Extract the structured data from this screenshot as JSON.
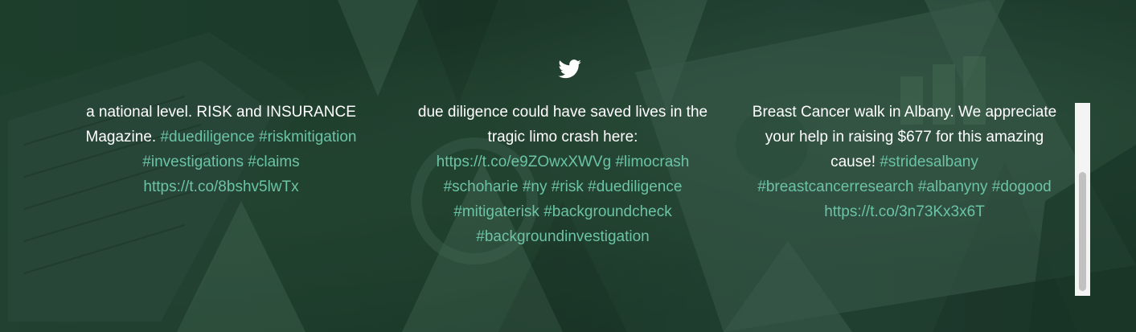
{
  "icons": {
    "twitter": "twitter-bird-icon"
  },
  "colors": {
    "link": "#6cc3a6",
    "text": "#ffffff",
    "background": "#1d3d2b"
  },
  "tweets": [
    {
      "lines": [
        {
          "parts": [
            {
              "t": "a national level. RISK and INSURANCE",
              "link": false
            }
          ]
        },
        {
          "parts": [
            {
              "t": "Magazine. ",
              "link": false
            },
            {
              "t": "#duediligence",
              "link": true
            },
            {
              "t": " ",
              "link": false
            },
            {
              "t": "#riskmitigation",
              "link": true
            }
          ]
        },
        {
          "parts": [
            {
              "t": "#investigations",
              "link": true
            },
            {
              "t": " ",
              "link": false
            },
            {
              "t": "#claims",
              "link": true
            }
          ]
        },
        {
          "parts": [
            {
              "t": "https://t.co/8bshv5lwTx",
              "link": true
            }
          ]
        }
      ]
    },
    {
      "lines": [
        {
          "parts": [
            {
              "t": "due diligence could have saved lives in the",
              "link": false
            }
          ]
        },
        {
          "parts": [
            {
              "t": "tragic limo crash here:",
              "link": false
            }
          ]
        },
        {
          "parts": [
            {
              "t": "https://t.co/e9ZOwxXWVg",
              "link": true
            },
            {
              "t": " ",
              "link": false
            },
            {
              "t": "#limocrash",
              "link": true
            }
          ]
        },
        {
          "parts": [
            {
              "t": "#schoharie",
              "link": true
            },
            {
              "t": " ",
              "link": false
            },
            {
              "t": "#ny",
              "link": true
            },
            {
              "t": " ",
              "link": false
            },
            {
              "t": "#risk",
              "link": true
            },
            {
              "t": " ",
              "link": false
            },
            {
              "t": "#duediligence",
              "link": true
            }
          ]
        },
        {
          "parts": [
            {
              "t": "#mitigaterisk",
              "link": true
            },
            {
              "t": " ",
              "link": false
            },
            {
              "t": "#backgroundcheck",
              "link": true
            }
          ]
        },
        {
          "parts": [
            {
              "t": "#backgroundinvestigation",
              "link": true
            }
          ]
        }
      ]
    },
    {
      "lines": [
        {
          "parts": [
            {
              "t": "Breast Cancer walk in Albany. We appreciate",
              "link": false
            }
          ]
        },
        {
          "parts": [
            {
              "t": "your help in raising $677 for this amazing",
              "link": false
            }
          ]
        },
        {
          "parts": [
            {
              "t": "cause! ",
              "link": false
            },
            {
              "t": "#stridesalbany",
              "link": true
            }
          ]
        },
        {
          "parts": [
            {
              "t": "#breastcancerresearch",
              "link": true
            },
            {
              "t": " ",
              "link": false
            },
            {
              "t": "#albanyny",
              "link": true
            },
            {
              "t": " ",
              "link": false
            },
            {
              "t": "#dogood",
              "link": true
            }
          ]
        },
        {
          "parts": [
            {
              "t": "https://t.co/3n73Kx3x6T",
              "link": true
            }
          ]
        }
      ]
    }
  ],
  "scrollbar": {
    "position": 0.36
  }
}
